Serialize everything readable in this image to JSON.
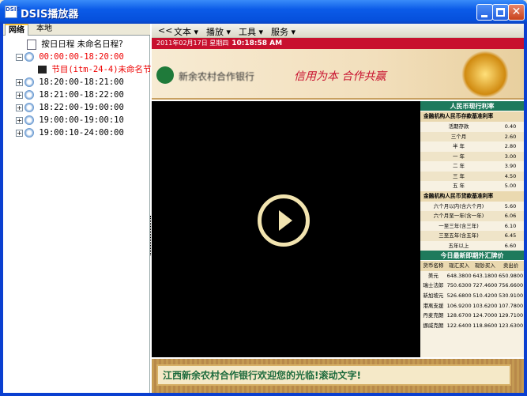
{
  "window": {
    "title": "DSIS播放器"
  },
  "tabs": [
    {
      "label": "网络"
    },
    {
      "label": "本地"
    }
  ],
  "tree": {
    "root": {
      "label": "按日日程  未命名日程?"
    },
    "items": [
      {
        "label": "00:00:00-18:20:00"
      },
      {
        "label": "节目(itm-24-4)未命名节目"
      },
      {
        "label": "18:20:00-18:21:00"
      },
      {
        "label": "18:21:00-18:22:00"
      },
      {
        "label": "18:22:00-19:00:00"
      },
      {
        "label": "19:00:00-19:00:10"
      },
      {
        "label": "19:00:10-24:00:00"
      }
    ]
  },
  "toolbar": {
    "back": "<<",
    "menus": [
      "文本",
      "播放",
      "工具",
      "服务"
    ]
  },
  "content": {
    "date": "2011年02月17日 星期四",
    "time": "10:18:58 AM",
    "bank_name": "新余农村合作银行",
    "slogan": "信用为本  合作共赢",
    "rates": {
      "title": "人民币现行利率",
      "deposit_title": "金融机构人民币存款基准利率",
      "deposit": [
        [
          "活期存款",
          "0.40"
        ],
        [
          "三个月",
          "2.60"
        ],
        [
          "半  年",
          "2.80"
        ],
        [
          "一  年",
          "3.00"
        ],
        [
          "二  年",
          "3.90"
        ],
        [
          "三  年",
          "4.50"
        ],
        [
          "五  年",
          "5.00"
        ]
      ],
      "loan_title": "金融机构人民币贷款基准利率",
      "loan": [
        [
          "六个月以内(含六个月)",
          "5.60"
        ],
        [
          "六个月至一年(含一年)",
          "6.06"
        ],
        [
          "一至三年(含三年)",
          "6.10"
        ],
        [
          "三至五年(含五年)",
          "6.45"
        ],
        [
          "五年以上",
          "6.60"
        ]
      ]
    },
    "fx": {
      "title": "今日最新即期外汇牌价",
      "headers": [
        "货币名称",
        "现汇买入",
        "现钞买入",
        "卖出价"
      ],
      "rows": [
        [
          "美元",
          "648.3800",
          "643.1800",
          "650.9800"
        ],
        [
          "瑞士法郎",
          "750.6300",
          "727.4600",
          "756.6600"
        ],
        [
          "新加坡元",
          "526.6800",
          "510.4200",
          "530.9100"
        ],
        [
          "港离支援",
          "106.9200",
          "103.6200",
          "107.7800"
        ],
        [
          "丹麦克朗",
          "128.6700",
          "124.7000",
          "129.7100"
        ],
        [
          "挪威克朗",
          "122.6400",
          "118.8600",
          "123.6300"
        ]
      ]
    },
    "ticker": "江西新余农村合作银行欢迎您的光临!滚动文字!"
  }
}
